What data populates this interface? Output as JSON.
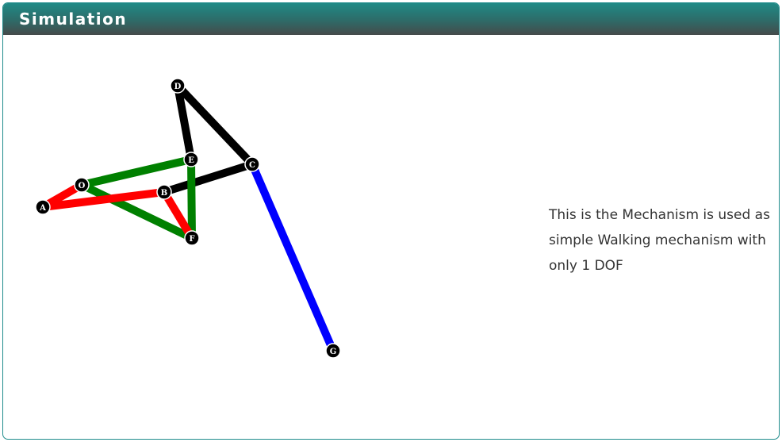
{
  "panel": {
    "title": "Simulation"
  },
  "description": {
    "lines": [
      "This is the Mechanism is used as",
      "simple Walking mechanism with",
      "only 1 DOF"
    ]
  },
  "mechanism": {
    "colors": {
      "red": "#ff0000",
      "green": "#008000",
      "black": "#000000",
      "blue": "#0000ff"
    },
    "joints": [
      "D",
      "E",
      "C",
      "O",
      "B",
      "A",
      "F",
      "G"
    ]
  }
}
